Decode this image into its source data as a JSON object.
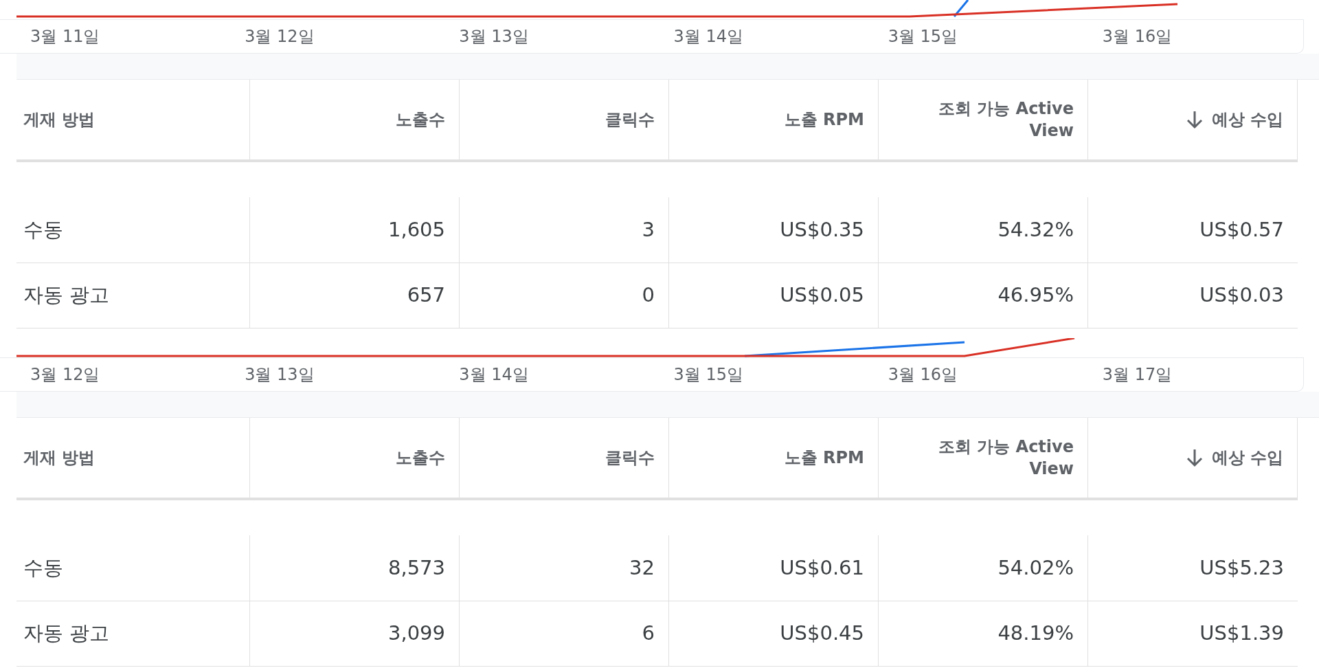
{
  "panels": [
    {
      "dates": [
        "3월 11일",
        "3월 12일",
        "3월 13일",
        "3월 14일",
        "3월 15일",
        "3월 16일"
      ],
      "columns": [
        {
          "label": "게재 방법",
          "sorted": false
        },
        {
          "label": "노출수",
          "sorted": false
        },
        {
          "label": "클릭수",
          "sorted": false
        },
        {
          "label": "노출 RPM",
          "sorted": false
        },
        {
          "label": "조회 가능 Active View",
          "sorted": false
        },
        {
          "label": "예상 수입",
          "sorted": true
        }
      ],
      "rows": [
        [
          "수동",
          "1,605",
          "3",
          "US$0.35",
          "54.32%",
          "US$0.57"
        ],
        [
          "자동 광고",
          "657",
          "0",
          "US$0.05",
          "46.95%",
          "US$0.03"
        ]
      ]
    },
    {
      "dates": [
        "3월 12일",
        "3월 13일",
        "3월 14일",
        "3월 15일",
        "3월 16일",
        "3월 17일"
      ],
      "columns": [
        {
          "label": "게재 방법",
          "sorted": false
        },
        {
          "label": "노출수",
          "sorted": false
        },
        {
          "label": "클릭수",
          "sorted": false
        },
        {
          "label": "노출 RPM",
          "sorted": false
        },
        {
          "label": "조회 가능 Active View",
          "sorted": false
        },
        {
          "label": "예상 수입",
          "sorted": true
        }
      ],
      "rows": [
        [
          "수동",
          "8,573",
          "32",
          "US$0.61",
          "54.02%",
          "US$5.23"
        ],
        [
          "자동 광고",
          "3,099",
          "6",
          "US$0.45",
          "48.19%",
          "US$1.39"
        ]
      ]
    }
  ]
}
